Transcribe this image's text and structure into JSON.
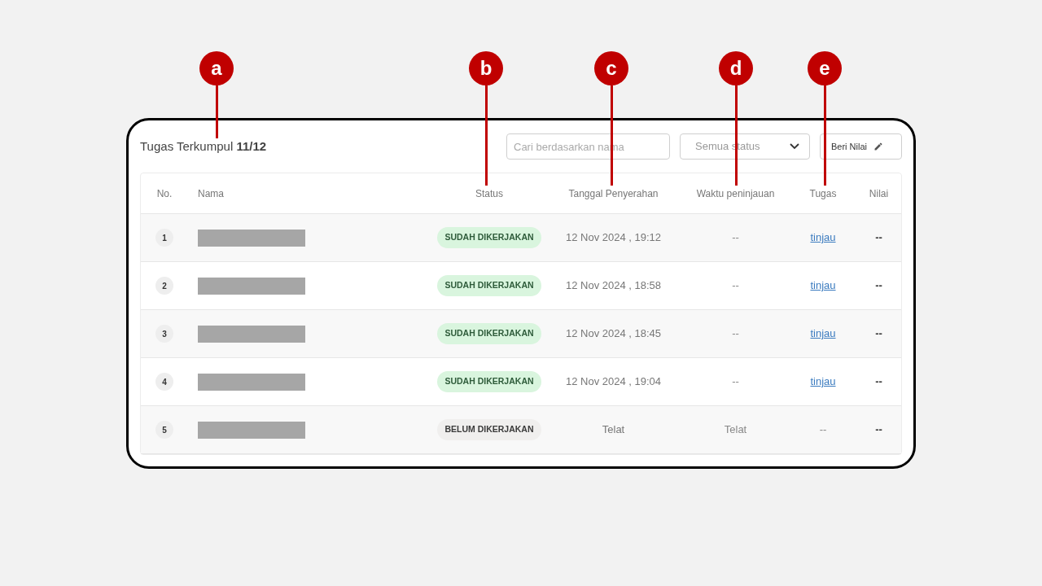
{
  "callouts": [
    {
      "letter": "a"
    },
    {
      "letter": "b"
    },
    {
      "letter": "c"
    },
    {
      "letter": "d"
    },
    {
      "letter": "e"
    }
  ],
  "header": {
    "title": "Tugas Terkumpul",
    "count": "11/12"
  },
  "search": {
    "placeholder": "Cari berdasarkan nama"
  },
  "status_filter": {
    "value": "Semua status"
  },
  "grade_button": {
    "label": "Beri Nilai"
  },
  "table": {
    "columns": [
      "No.",
      "Nama",
      "Status",
      "Tanggal Penyerahan",
      "Waktu peninjauan",
      "Tugas",
      "Nilai"
    ],
    "rows": [
      {
        "no": "1",
        "status": {
          "label": "SUDAH DIKERJAKAN",
          "kind": "done"
        },
        "submitted": "12 Nov 2024 , 19:12",
        "reviewed": "--",
        "task": {
          "label": "tinjau",
          "kind": "link"
        },
        "score": "--"
      },
      {
        "no": "2",
        "status": {
          "label": "SUDAH DIKERJAKAN",
          "kind": "done"
        },
        "submitted": "12 Nov 2024 , 18:58",
        "reviewed": "--",
        "task": {
          "label": "tinjau",
          "kind": "link"
        },
        "score": "--"
      },
      {
        "no": "3",
        "status": {
          "label": "SUDAH DIKERJAKAN",
          "kind": "done"
        },
        "submitted": "12 Nov 2024 , 18:45",
        "reviewed": "--",
        "task": {
          "label": "tinjau",
          "kind": "link"
        },
        "score": "--"
      },
      {
        "no": "4",
        "status": {
          "label": "SUDAH DIKERJAKAN",
          "kind": "done"
        },
        "submitted": "12 Nov 2024 , 19:04",
        "reviewed": "--",
        "task": {
          "label": "tinjau",
          "kind": "link"
        },
        "score": "--"
      },
      {
        "no": "5",
        "status": {
          "label": "BELUM DIKERJAKAN",
          "kind": "pending"
        },
        "submitted": "Telat",
        "reviewed": "Telat",
        "task": {
          "label": "--",
          "kind": "text"
        },
        "score": "--"
      }
    ]
  }
}
